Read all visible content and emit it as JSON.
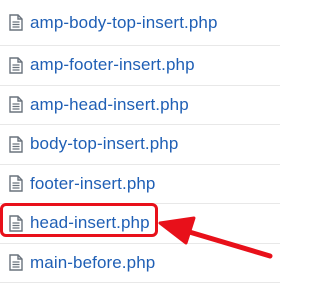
{
  "files": [
    {
      "name": "amp-body-top-insert.php",
      "icon": "file-icon"
    },
    {
      "name": "amp-footer-insert.php",
      "icon": "file-icon"
    },
    {
      "name": "amp-head-insert.php",
      "icon": "file-icon"
    },
    {
      "name": "body-top-insert.php",
      "icon": "file-icon"
    },
    {
      "name": "footer-insert.php",
      "icon": "file-icon"
    },
    {
      "name": "head-insert.php",
      "icon": "file-icon"
    },
    {
      "name": "main-before.php",
      "icon": "file-icon"
    }
  ],
  "highlight": {
    "target": "head-insert.php",
    "color": "#e8101a"
  },
  "colors": {
    "link": "#1f5fb5",
    "divider": "#e8e8e8",
    "annotation": "#e8101a"
  }
}
